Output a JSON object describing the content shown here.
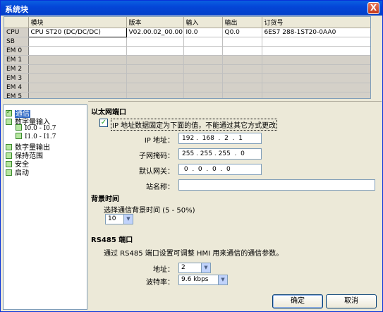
{
  "window": {
    "title": "系统块",
    "close": "X"
  },
  "table": {
    "columns": [
      "",
      "模块",
      "版本",
      "输入",
      "输出",
      "订货号"
    ],
    "rows": [
      {
        "slot": "CPU",
        "module": "CPU ST20 (DC/DC/DC)",
        "version": "V02.00.02_00.00...",
        "input": "I0.0",
        "output": "Q0.0",
        "order": "6ES7 288-1ST20-0AA0"
      },
      {
        "slot": "SB",
        "module": "",
        "version": "",
        "input": "",
        "output": "",
        "order": ""
      },
      {
        "slot": "EM 0",
        "module": "",
        "version": "",
        "input": "",
        "output": "",
        "order": ""
      },
      {
        "slot": "EM 1",
        "module": "",
        "version": "",
        "input": "",
        "output": "",
        "order": ""
      },
      {
        "slot": "EM 2",
        "module": "",
        "version": "",
        "input": "",
        "output": "",
        "order": ""
      },
      {
        "slot": "EM 3",
        "module": "",
        "version": "",
        "input": "",
        "output": "",
        "order": ""
      },
      {
        "slot": "EM 4",
        "module": "",
        "version": "",
        "input": "",
        "output": "",
        "order": ""
      },
      {
        "slot": "EM 5",
        "module": "",
        "version": "",
        "input": "",
        "output": "",
        "order": ""
      }
    ]
  },
  "tree": [
    {
      "label": "通信",
      "selected": true
    },
    {
      "label": "数字量输入"
    },
    {
      "label": "I0.0 - I0.7",
      "sub": true
    },
    {
      "label": "I1.0 - I1.7",
      "sub": true
    },
    {
      "label": "数字量输出"
    },
    {
      "label": "保持范围"
    },
    {
      "label": "安全"
    },
    {
      "label": "启动"
    }
  ],
  "ethernet": {
    "header": "以太网端口",
    "fixed_checkbox_label": "IP 地址数据固定为下面的值，不能通过其它方式更改",
    "ip_label": "IP 地址：",
    "ip": [
      "192",
      "168",
      "2",
      "1"
    ],
    "mask_label": "子网掩码：",
    "mask": [
      "255",
      "255",
      "255",
      "0"
    ],
    "gateway_label": "默认网关：",
    "gateway": [
      "0",
      "0",
      "0",
      "0"
    ],
    "station_label": "站名称：",
    "station_value": ""
  },
  "background": {
    "header": "背景时间",
    "label": "选择通信背景时间 (5 - 50%)",
    "value": "10"
  },
  "rs485": {
    "header": "RS485 端口",
    "desc": "通过 RS485 端口设置可调整 HMI 用来通信的通信参数。",
    "address_label": "地址：",
    "address": "2",
    "baud_label": "波特率：",
    "baud": "9.6 kbps"
  },
  "buttons": {
    "ok": "确定",
    "cancel": "取消"
  }
}
